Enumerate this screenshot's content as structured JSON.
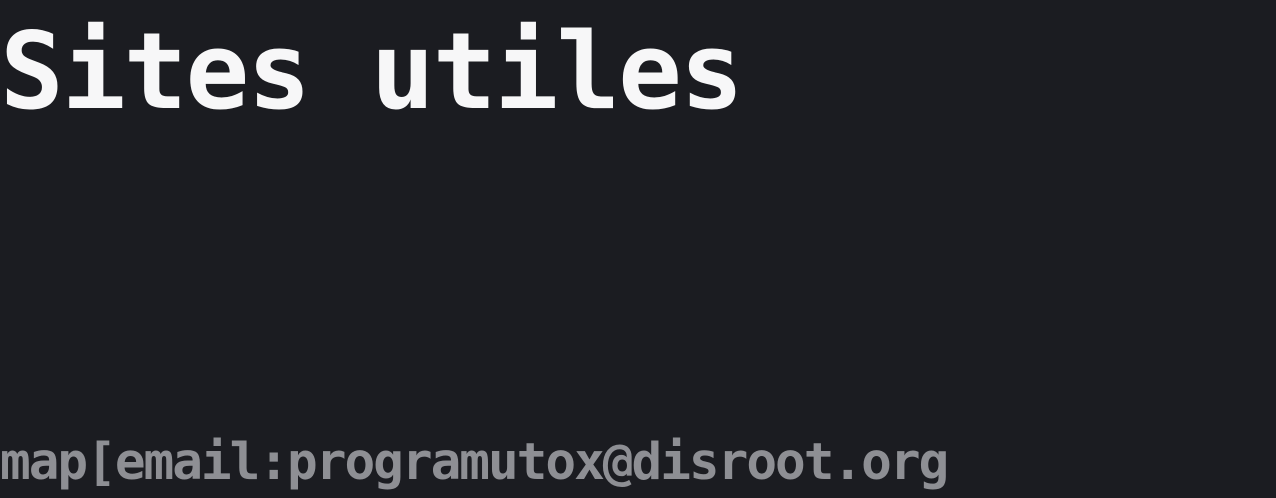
{
  "page": {
    "title": "Sites utiles",
    "author_line": "map[email:programutox@disroot.org"
  },
  "colors": {
    "background": "#1b1c21",
    "title": "#f7f7f8",
    "meta": "#8e8f94"
  }
}
